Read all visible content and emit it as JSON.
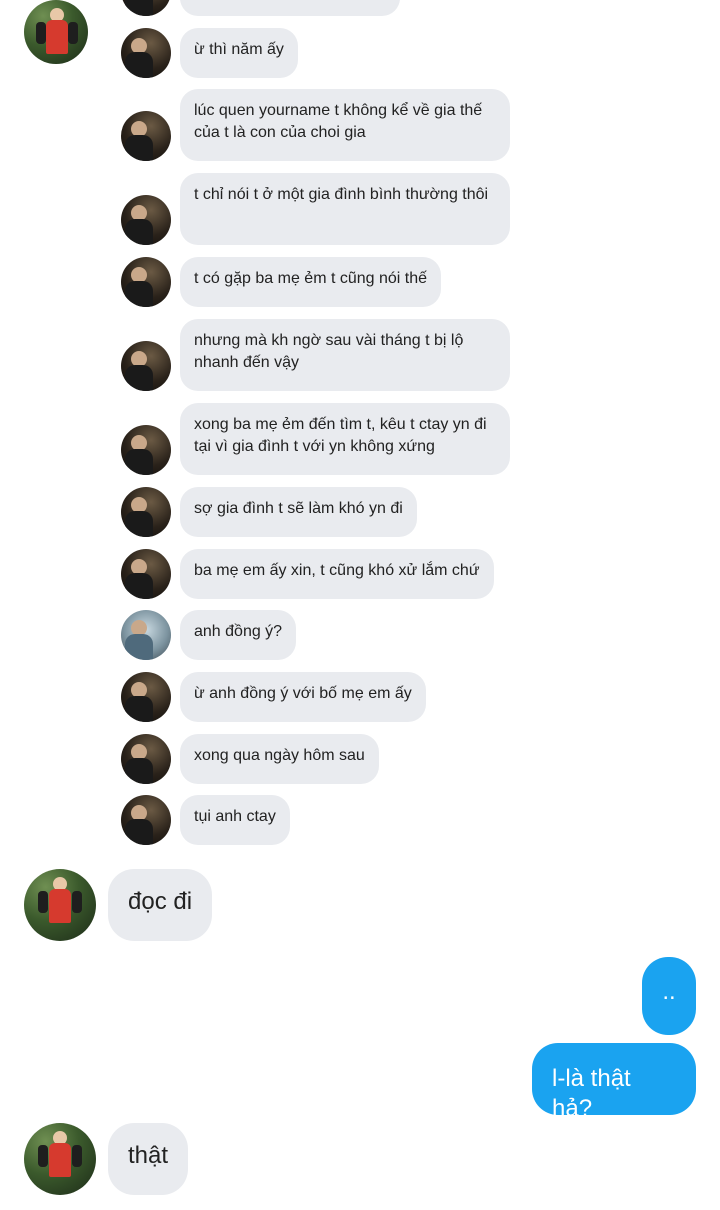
{
  "conversation": {
    "quoted_messages": [
      "ừ thì năm ấy",
      "lúc quen yourname t không kể về gia thế của t là con của choi gia",
      "t chỉ nói t ở một gia đình bình thường thôi",
      "t có gặp ba mẹ ẻm t cũng nói thế",
      "nhưng mà kh ngờ sau vài tháng t bị lộ nhanh đến vậy",
      "xong ba mẹ ẻm đến tìm t, kêu t ctay yn đi tại vì gia đình t với yn không xứng",
      "sợ gia đình t sẽ làm khó yn đi",
      "ba mẹ em ấy xin, t cũng khó xử lắm chứ",
      "anh đồng ý?",
      "ừ anh đồng ý với bố mẹ em ấy",
      "xong qua ngày hôm sau",
      "tụi anh ctay"
    ],
    "incoming_1": "đọc đi",
    "outgoing_1": "..",
    "outgoing_2": "l-là thật hả?",
    "incoming_2": "thật"
  },
  "colors": {
    "incoming_bubble": "#e9ebef",
    "outgoing_bubble": "#1aa3f0",
    "background": "#ffffff"
  }
}
